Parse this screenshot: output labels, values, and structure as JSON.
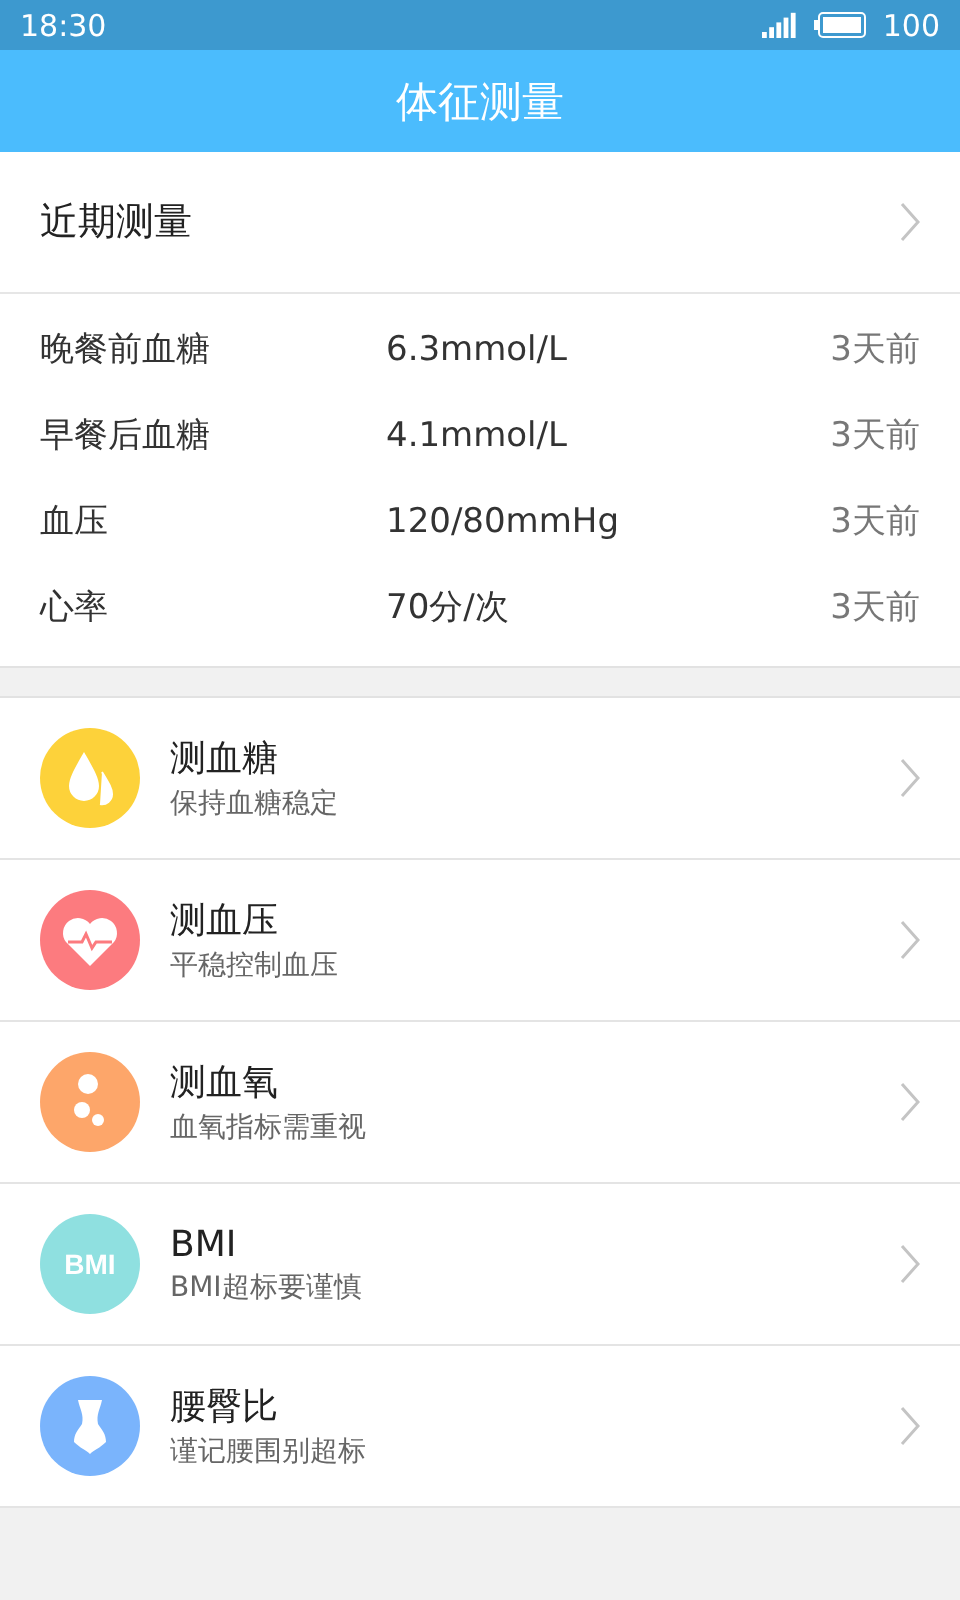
{
  "status_bar": {
    "time": "18:30",
    "battery": "100"
  },
  "header": {
    "title": "体征测量"
  },
  "recent": {
    "label": "近期测量"
  },
  "measurements": [
    {
      "name": "晚餐前血糖",
      "value": "6.3mmol/L",
      "when": "3天前"
    },
    {
      "name": "早餐后血糖",
      "value": "4.1mmol/L",
      "when": "3天前"
    },
    {
      "name": "血压",
      "value": "120/80mmHg",
      "when": "3天前"
    },
    {
      "name": "心率",
      "value": "70分/次",
      "when": "3天前"
    }
  ],
  "tests": [
    {
      "kind": "drop",
      "color": "#fdd23a",
      "title": "测血糖",
      "subtitle": "保持血糖稳定"
    },
    {
      "kind": "heart",
      "color": "#fc7b7f",
      "title": "测血压",
      "subtitle": "平稳控制血压"
    },
    {
      "kind": "bubbles",
      "color": "#fda66a",
      "title": "测血氧",
      "subtitle": "血氧指标需重视"
    },
    {
      "kind": "badge",
      "color": "#8fe0e0",
      "icon_text": "BMI",
      "title": "BMI",
      "subtitle": "BMI超标要谨慎"
    },
    {
      "kind": "body",
      "color": "#7ab4fc",
      "title": "腰臀比",
      "subtitle": "谨记腰围别超标"
    }
  ]
}
